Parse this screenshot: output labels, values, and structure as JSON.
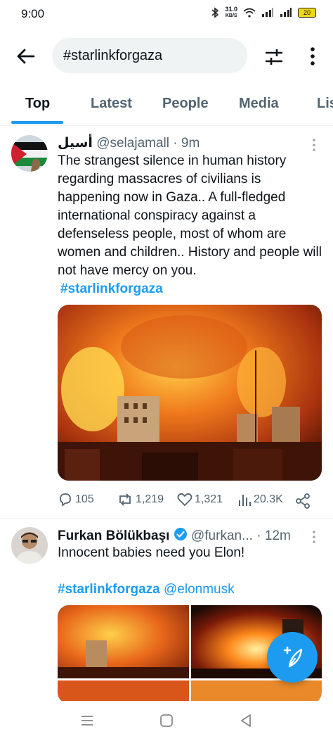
{
  "status_bar": {
    "time": "9:00",
    "speed_value": "31.0",
    "speed_unit": "KB/S",
    "battery": "20"
  },
  "search": {
    "query": "#starlinkforgaza"
  },
  "tabs": [
    {
      "label": "Top"
    },
    {
      "label": "Latest"
    },
    {
      "label": "People"
    },
    {
      "label": "Media"
    },
    {
      "label": "Lis"
    }
  ],
  "tweets": [
    {
      "name": "أسيل",
      "handle": "@selajamall",
      "dot": "·",
      "time": "9m",
      "text": "The strangest silence in human history regarding massacres of civilians is happening now in Gaza.. A full-fledged international conspiracy against a defenseless people, most of whom are women and children.. History and people will not have mercy on you.",
      "hashtag": "#starlinkforgaza",
      "replies": "105",
      "reposts": "1,219",
      "likes": "1,321",
      "views": "20.3K"
    },
    {
      "name": "Furkan Bölükbaşı",
      "handle": "@furkan...",
      "dot": "·",
      "time": "12m",
      "text": "Innocent babies need you Elon!",
      "hashtag": "#starlinkforgaza",
      "mention": "@elonmusk"
    }
  ],
  "colors": {
    "accent": "#1d9bf0",
    "text": "#0f1419",
    "muted": "#536471",
    "search_bg": "#eff3f4"
  },
  "icons": [
    "back-arrow-icon",
    "filter-icon",
    "more-vertical-icon",
    "reply-icon",
    "repost-icon",
    "like-icon",
    "views-icon",
    "share-icon",
    "verified-icon",
    "compose-icon"
  ]
}
